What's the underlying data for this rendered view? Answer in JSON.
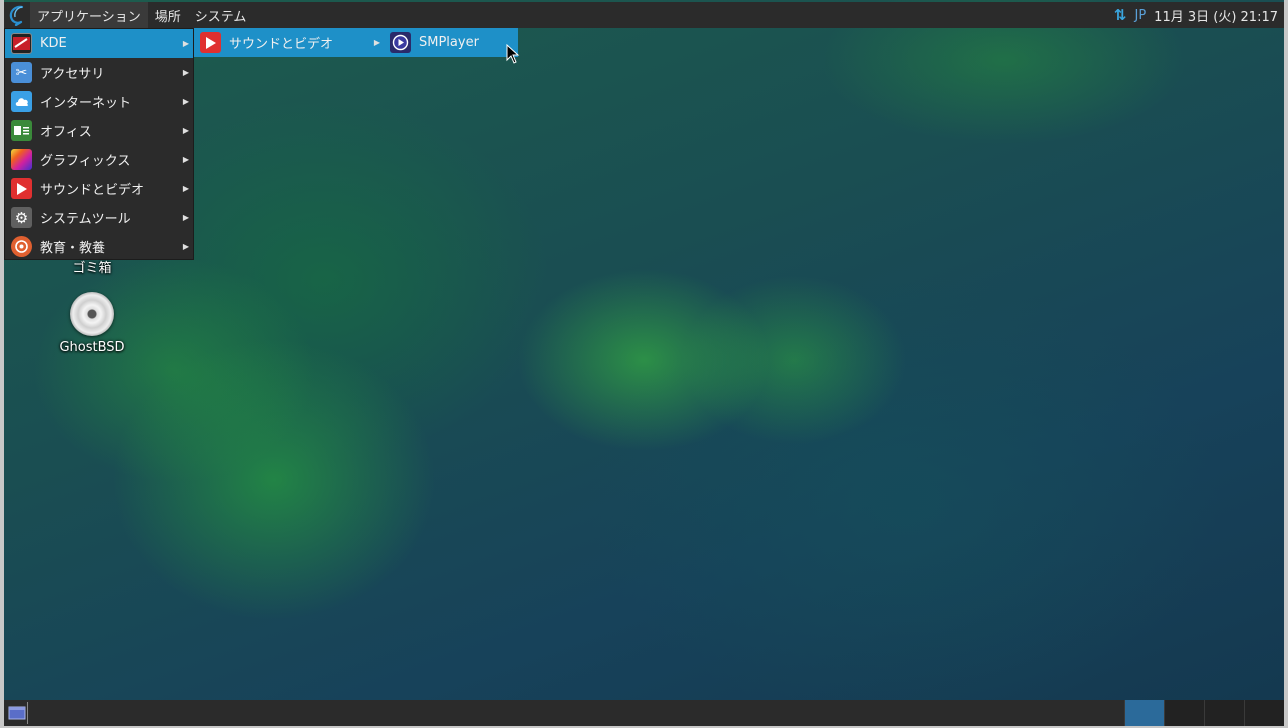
{
  "top_panel": {
    "menus": [
      {
        "label": "アプリケーション"
      },
      {
        "label": "場所"
      },
      {
        "label": "システム"
      }
    ],
    "tray": {
      "network_icon": "network-updown-icon",
      "lang": "JP",
      "datetime": "11月 3日 (火) 21:17"
    }
  },
  "app_menu": {
    "items": [
      {
        "label": "KDE",
        "icon": "kde-icon",
        "color": "#c8202a"
      },
      {
        "label": "アクセサリ",
        "icon": "scissors-icon",
        "color": "#4a8fd8"
      },
      {
        "label": "インターネット",
        "icon": "cloud-icon",
        "color": "#3aa0e6"
      },
      {
        "label": "オフィス",
        "icon": "office-icon",
        "color": "#3a8a3a"
      },
      {
        "label": "グラフィックス",
        "icon": "graphics-icon",
        "color": "#c040c0"
      },
      {
        "label": "サウンドとビデオ",
        "icon": "play-icon",
        "color": "#e03030"
      },
      {
        "label": "システムツール",
        "icon": "gear-icon",
        "color": "#606060"
      },
      {
        "label": "教育・教養",
        "icon": "education-icon",
        "color": "#e06030"
      }
    ]
  },
  "submenu_kde": {
    "items": [
      {
        "label": "サウンドとビデオ",
        "icon": "play-icon"
      }
    ]
  },
  "submenu_sound": {
    "items": [
      {
        "label": "SMPlayer",
        "icon": "smplayer-icon"
      }
    ]
  },
  "desktop": {
    "icons": [
      {
        "label": "ゴミ箱"
      },
      {
        "label": "GhostBSD"
      }
    ]
  },
  "colors": {
    "panel_bg": "#2b2b2b",
    "highlight": "#1e90c8",
    "active_workspace": "#2b6a9a"
  }
}
